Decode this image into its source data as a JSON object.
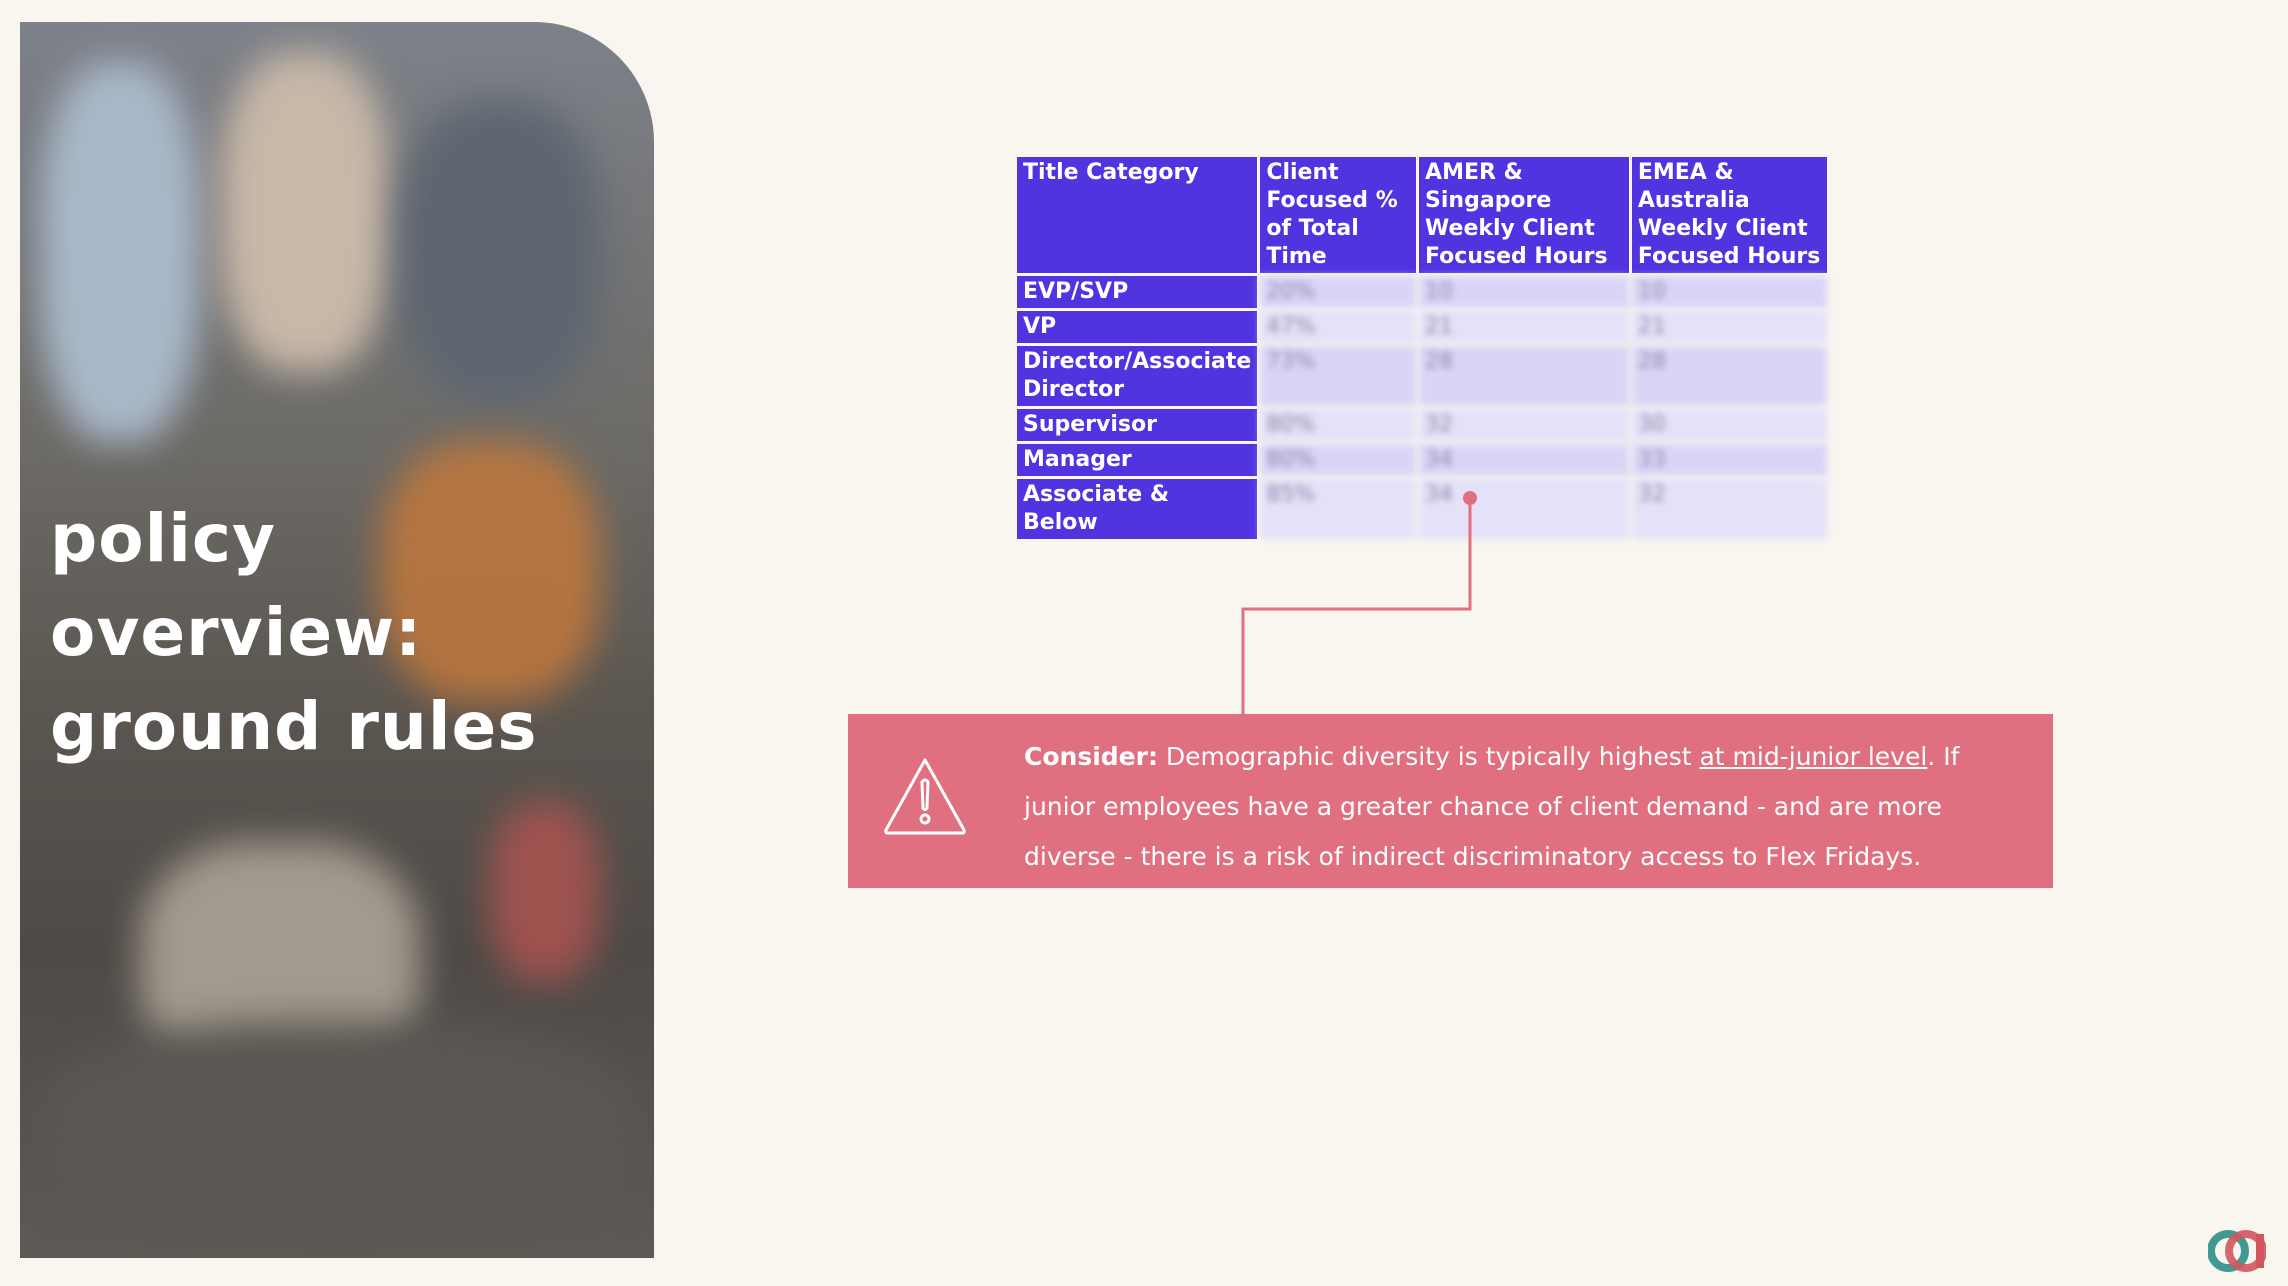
{
  "slide": {
    "title_lines": [
      "policy",
      "overview:",
      "ground rules"
    ]
  },
  "table": {
    "headers": [
      "Title Category",
      "Client Focused % of Total Time",
      "AMER & Singapore Weekly Client Focused Hours",
      "EMEA & Australia Weekly Client Focused Hours"
    ],
    "rows": [
      {
        "category": "EVP/SVP",
        "pct": "20%",
        "amer": "10",
        "emea": "10"
      },
      {
        "category": "VP",
        "pct": "47%",
        "amer": "21",
        "emea": "21"
      },
      {
        "category": "Director/Associate Director",
        "pct": "73%",
        "amer": "28",
        "emea": "28"
      },
      {
        "category": "Supervisor",
        "pct": "80%",
        "amer": "32",
        "emea": "30"
      },
      {
        "category": "Manager",
        "pct": "80%",
        "amer": "34",
        "emea": "33"
      },
      {
        "category": "Associate & Below",
        "pct": "85%",
        "amer": "34",
        "emea": "32"
      }
    ]
  },
  "callout": {
    "lead": "Consider:",
    "text_before_link": " Demographic diversity is typically highest ",
    "link_text": "at mid-junior level",
    "text_after_link": ". If junior employees have a greater chance of client demand - and are more diverse - there is a risk of indirect discriminatory access to Flex Fridays.",
    "icon": "warning-triangle-icon"
  },
  "colors": {
    "table_header": "#5133e0",
    "callout_bg": "#e07080",
    "background": "#f9f6f0"
  }
}
